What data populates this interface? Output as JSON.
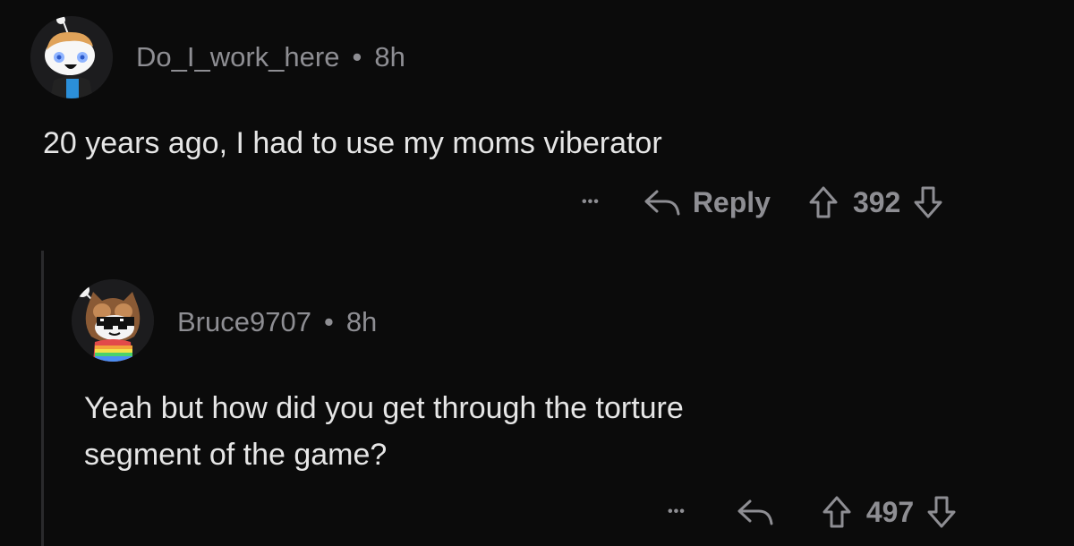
{
  "comments": [
    {
      "username": "Do_I_work_here",
      "separator": "•",
      "age": "8h",
      "body": "20 years ago, I had to use my moms viberator",
      "more_label": "•••",
      "reply_label": "Reply",
      "votes": "392"
    },
    {
      "username": "Bruce9707",
      "separator": "•",
      "age": "8h",
      "body_lines": [
        "Yeah but how did you get through the torture",
        "segment of the game?"
      ],
      "more_label": "•••",
      "votes": "497"
    }
  ],
  "colors": {
    "background": "#0b0b0b",
    "text": "#e6e6e6",
    "meta": "#8e8e93",
    "thread_line": "#2a2a2c"
  },
  "icons": {
    "reply": "reply-arrow-icon",
    "upvote": "upvote-arrow-icon",
    "downvote": "downvote-arrow-icon",
    "more": "more-options-icon"
  }
}
